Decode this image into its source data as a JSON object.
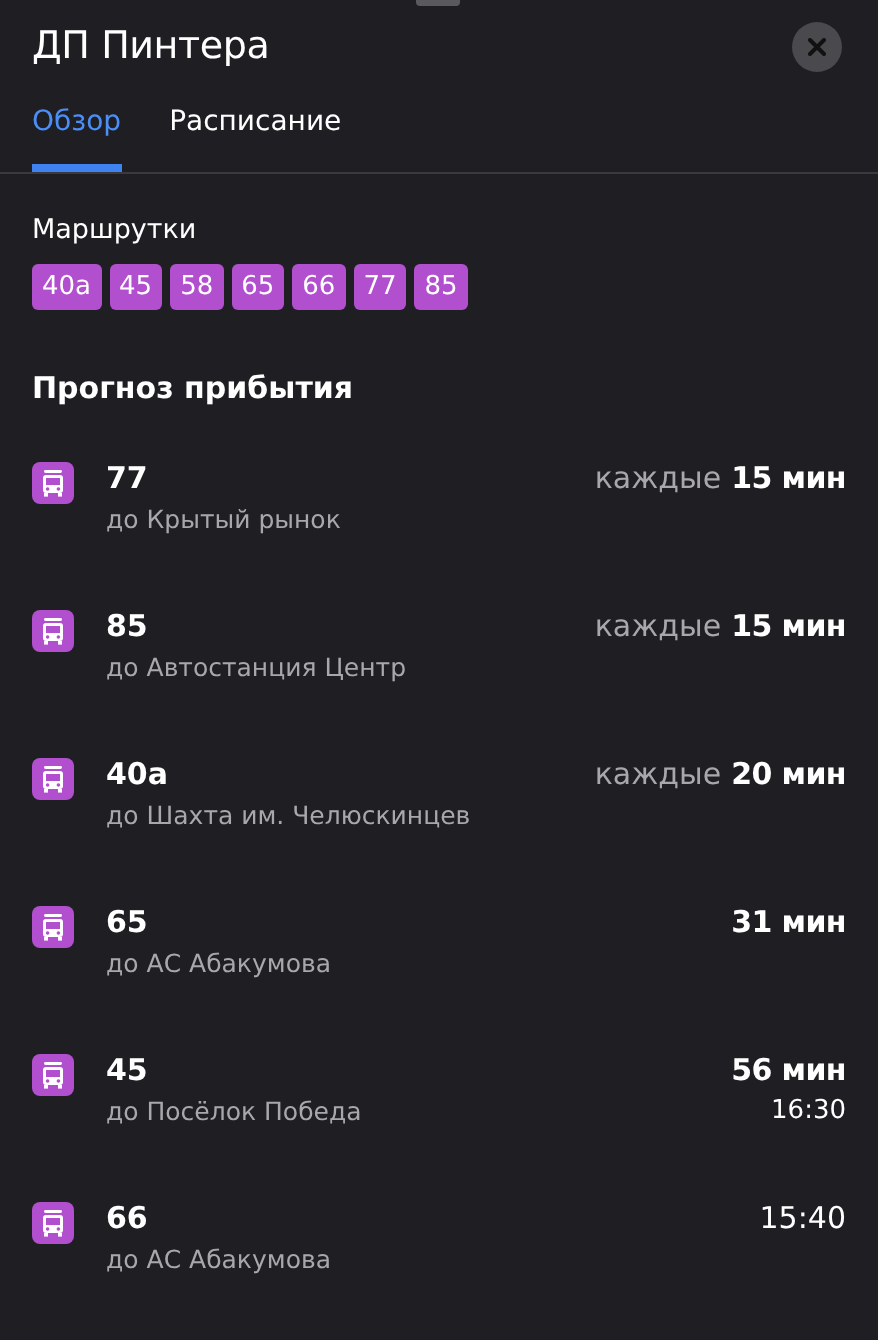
{
  "header": {
    "title": "ДП Пинтера"
  },
  "tabs": [
    {
      "label": "Обзор",
      "selected": true
    },
    {
      "label": "Расписание",
      "selected": false
    }
  ],
  "routes": {
    "title": "Маршрутки",
    "items": [
      "40а",
      "45",
      "58",
      "65",
      "66",
      "77",
      "85"
    ]
  },
  "forecast": {
    "title": "Прогноз прибытия",
    "rows": [
      {
        "kind": "interval",
        "number": "77",
        "destination": "до Крытый рынок",
        "prefix": "каждые",
        "value": "15 мин"
      },
      {
        "kind": "interval",
        "number": "85",
        "destination": "до Автостанция Центр",
        "prefix": "каждые",
        "value": "15 мин"
      },
      {
        "kind": "interval",
        "number": "40а",
        "destination": "до Шахта им. Челюскинцев",
        "prefix": "каждые",
        "value": "20 мин"
      },
      {
        "kind": "eta",
        "number": "65",
        "destination": "до АС Абакумова",
        "value": "31 мин"
      },
      {
        "kind": "eta",
        "number": "45",
        "destination": "до Посёлок Победа",
        "value": "56 мин",
        "time": "16:30"
      },
      {
        "kind": "scheduled",
        "number": "66",
        "destination": "до АС Абакумова",
        "time": "15:40"
      }
    ]
  }
}
